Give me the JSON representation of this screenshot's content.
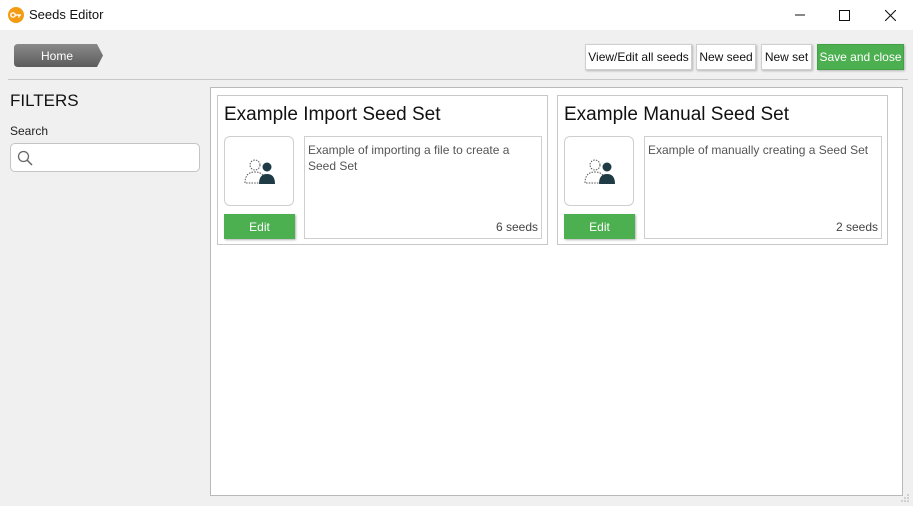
{
  "window": {
    "title": "Seeds Editor",
    "app_icon": "key-icon",
    "controls": {
      "minimize": "minimize-icon",
      "maximize": "maximize-icon",
      "close": "close-icon"
    }
  },
  "toolbar": {
    "home_label": "Home",
    "view_edit_label": "View/Edit all seeds",
    "new_seed_label": "New seed",
    "new_set_label": "New set",
    "save_close_label": "Save and close"
  },
  "filters": {
    "title": "FILTERS",
    "search_label": "Search",
    "search_value": "",
    "search_icon": "search-icon"
  },
  "seed_sets": [
    {
      "title": "Example Import Seed Set",
      "description": "Example of importing a file to create a Seed Set",
      "seed_count": "6 seeds",
      "edit_label": "Edit",
      "icon": "users-icon"
    },
    {
      "title": "Example Manual Seed Set",
      "description": "Example of manually creating a Seed Set",
      "seed_count": "2 seeds",
      "edit_label": "Edit",
      "icon": "users-icon"
    }
  ],
  "colors": {
    "accent_green": "#4caf50",
    "home_gray": "#6e6e6e",
    "app_icon_orange": "#f39c12"
  }
}
